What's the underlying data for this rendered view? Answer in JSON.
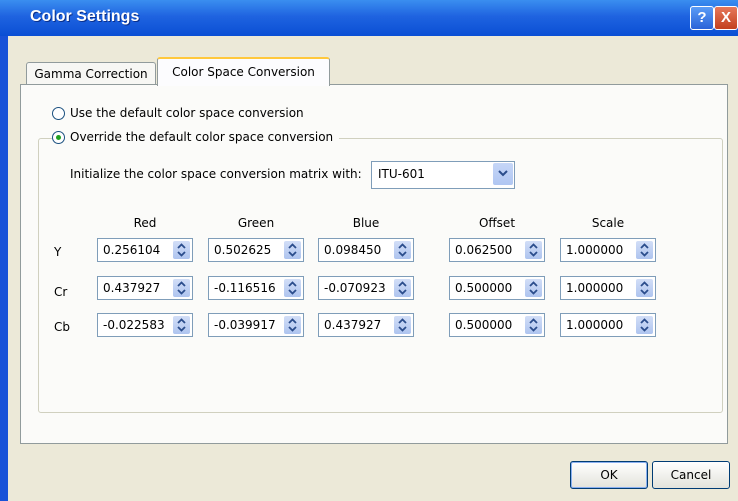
{
  "window": {
    "title": "Color Settings",
    "help_label": "?",
    "close_label": "X"
  },
  "tabs": [
    {
      "label": "Gamma Correction"
    },
    {
      "label": "Color Space Conversion"
    }
  ],
  "radios": {
    "default": {
      "label": "Use the default color space conversion",
      "checked": false
    },
    "override": {
      "label": "Override the default color space conversion",
      "checked": true
    }
  },
  "init": {
    "label": "Initialize the color space conversion matrix with:",
    "value": "ITU-601"
  },
  "matrix": {
    "headers": [
      "Red",
      "Green",
      "Blue",
      "Offset",
      "Scale"
    ],
    "rows": [
      {
        "label": "Y",
        "values": [
          "0.256104",
          "0.502625",
          "0.098450",
          "0.062500",
          "1.000000"
        ]
      },
      {
        "label": "Cr",
        "values": [
          "0.437927",
          "-0.116516",
          "-0.070923",
          "0.500000",
          "1.000000"
        ]
      },
      {
        "label": "Cb",
        "values": [
          "-0.022583",
          "-0.039917",
          "0.437927",
          "0.500000",
          "1.000000"
        ]
      }
    ]
  },
  "buttons": {
    "ok": "OK",
    "cancel": "Cancel"
  }
}
